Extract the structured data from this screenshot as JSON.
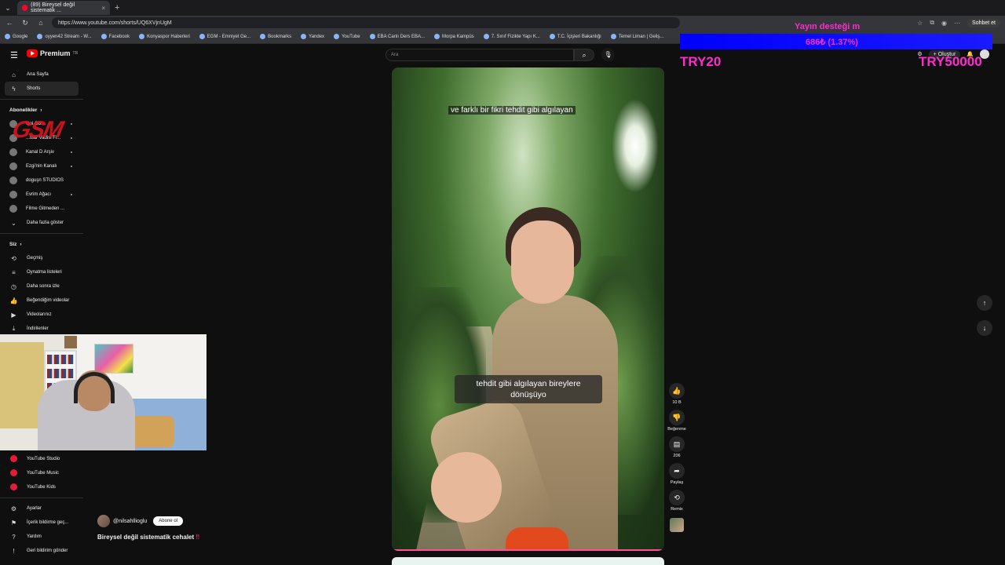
{
  "browser": {
    "tab_title": "(89) Bireysel değil sistematik ...",
    "url": "https://www.youtube.com/shorts/UQ6XVjnUgM",
    "chat_label": "Sohbet et",
    "bookmarks": [
      "Google",
      "oyyen42 Stream - W...",
      "Facebook",
      "Konyaspor Haberleri",
      "EGM - Emniyet Ge...",
      "Bookmarks",
      "Yandex",
      "YouTube",
      "EBA Canlı Ders EBA...",
      "Morpa Kampüs",
      "7. Sınıf Fizikte Yapı K...",
      "T.C. İçişleri Bakanlığı",
      "Temel Liman | Geliş..."
    ]
  },
  "masthead": {
    "logo_text": "Premium",
    "logo_sup": "TR",
    "search_placeholder": "Ara",
    "create_label": "Oluştur"
  },
  "sidebar": {
    "primary": [
      {
        "label": "Ana Sayfa",
        "icon": "home-icon"
      },
      {
        "label": "Shorts",
        "icon": "shorts-icon"
      }
    ],
    "subs_heading": "Abonelikler",
    "subscriptions": [
      "Ooi Gö...",
      "...ttlar Vadisi Fi...",
      "Kanal D Arşiv",
      "Ezgi'nin Kanalı",
      "doguşn STUDIOS",
      "Evrim Ağacı",
      "Filme Gitmeden ..."
    ],
    "show_more": "Daha fazla göster",
    "you_heading": "Siz",
    "you_items": [
      "Geçmiş",
      "Oynatma listeleri",
      "Daha sonra izle",
      "Beğendiğim videolar",
      "Videolarınız",
      "İndirilenler"
    ],
    "more_from": [
      "YouTube Studio",
      "YouTube Music",
      "YouTube Kids"
    ],
    "bottom": [
      "Ayarlar",
      "İçerik bildirme geç...",
      "Yardım",
      "Geri bildirim gönder"
    ]
  },
  "video": {
    "caption_top": "ve farklı bir fikri tehdit gibi algılayan",
    "caption_main": "tehdit gibi algılayan bireylere dönüşüyo",
    "channel": "@nilsahllioglu",
    "subscribe_label": "Abone ol",
    "title": "Bireysel değil sistematik cehalet",
    "title_emoji": "‼"
  },
  "actions": {
    "likes": "10 B",
    "dislike_label": "Beğenme",
    "comments": "206",
    "share_label": "Paylaş",
    "remix_label": "Remix"
  },
  "stream_overlay": {
    "goal_title": "Yayın desteği m",
    "goal_amount": "686₺ (1.37%)",
    "goal_fraction": 0.0137,
    "try_left": "TRY20",
    "try_right": "TRY50000",
    "overlay_color": "#ff2bd0"
  }
}
